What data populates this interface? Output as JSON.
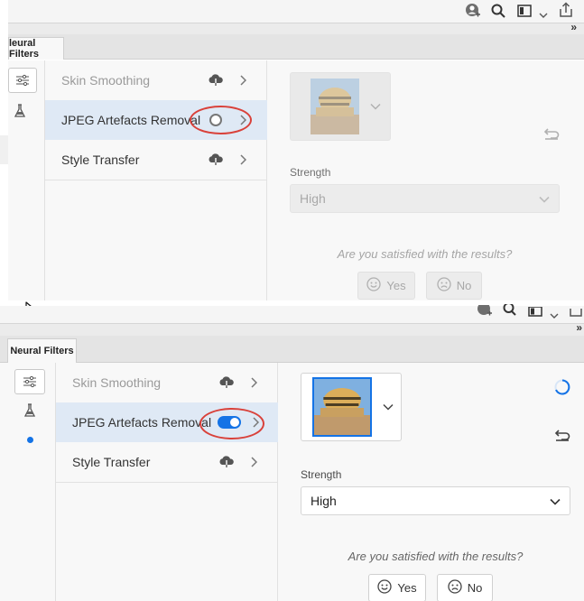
{
  "panel_title": "Neural Filters",
  "panel_title_cropped": "leural Filters",
  "expand_glyph": "»",
  "filters": [
    {
      "label": "Skin Smoothing",
      "state": "cloud-download"
    },
    {
      "label": "JPEG Artefacts Removal",
      "state": "toggle"
    },
    {
      "label": "Style Transfer",
      "state": "cloud-download"
    }
  ],
  "settings": {
    "strength_label": "Strength",
    "strength_value": "High",
    "feedback_question": "Are you satisfied with the results?",
    "yes_label": "Yes",
    "no_label": "No"
  },
  "before": {
    "toggle_state": "off"
  },
  "after": {
    "toggle_state": "on"
  },
  "colors": {
    "accent": "#1473e6",
    "annotation": "#d9413a",
    "selected_row": "#dfe9f5"
  },
  "icons": [
    "account-icon",
    "search-icon",
    "workspace-icon",
    "chevron-down-icon",
    "share-icon",
    "filter-sliders-icon",
    "flask-icon",
    "cloud-download-icon",
    "chevron-right-icon",
    "reset-icon",
    "spinner-icon",
    "smile-icon",
    "frown-icon",
    "cursor-icon"
  ]
}
